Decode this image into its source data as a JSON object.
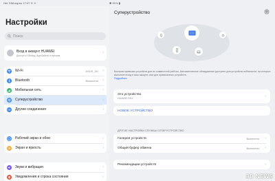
{
  "statusbar": {
    "left": "Нет SIM-карты 17:07 ✈ ᯤ",
    "right": "✱ 91% ▮"
  },
  "left": {
    "title": "Настройки",
    "search_placeholder": "Поиск",
    "account": {
      "title": "Вход в аккаунт HUAWEI",
      "subtitle": "Доступ к Облаку, AppGallery и прочим"
    },
    "group1": [
      {
        "label": "Wi-Fi",
        "value": "ASUS_5G",
        "icon_color": "#3a86f5",
        "icon": "wifi-icon"
      },
      {
        "label": "Bluetooth",
        "value": "Включено",
        "icon_color": "#3a86f5",
        "icon": "bluetooth-icon"
      },
      {
        "label": "Мобильная сеть",
        "value": "",
        "icon_color": "#33b86b",
        "icon": "mobile-network-icon"
      },
      {
        "label": "Суперустройство",
        "value": "",
        "icon_color": "#3a86f5",
        "icon": "super-device-icon"
      },
      {
        "label": "Другие соединения",
        "value": "",
        "icon_color": "#3a86f5",
        "icon": "link-icon"
      }
    ],
    "group2": [
      {
        "label": "Рабочий экран и обои",
        "value": "",
        "icon_color": "#3a86f5",
        "icon": "wallpaper-icon"
      },
      {
        "label": "Экран и яркость",
        "value": "",
        "icon_color": "#f2a93b",
        "icon": "brightness-icon"
      }
    ],
    "group3": [
      {
        "label": "Звуки и вибрация",
        "value": "",
        "icon_color": "#7a5bf0",
        "icon": "sound-icon"
      },
      {
        "label": "Уведомления и строка состояния",
        "value": "",
        "icon_color": "#e8543b",
        "icon": "notification-icon"
      }
    ]
  },
  "right": {
    "title": "Суперустройство",
    "description": "Быстрая привязка устройств для их совместной работы. Автоматическое обнаружение доступно для устройств поблизости, на которых выполнен вход в ваш аккаунт, или для привязанных устройств.",
    "more_link": "Подробнее",
    "this_device": {
      "title": "Это устройство",
      "subtitle": "HUAWEI DKX"
    },
    "new_device": "НОВОЕ УСТРОЙСТВО",
    "section_title": "ДРУГИЕ НАСТРОЙКИ СЛУЖБЫ СУПЕРУСТРОЙСТВО",
    "settings": [
      {
        "label": "Галерея устройств",
        "value": "Включено"
      },
      {
        "label": "Общий буфер обмена",
        "value": "Включено"
      }
    ],
    "recommendations": "Рекомендации устройств"
  },
  "watermark": "3D NEWS",
  "colors": {
    "accent": "#2a6ae0",
    "selected_bg": "#dce9fb",
    "device_icon": "#2a6ae0"
  }
}
